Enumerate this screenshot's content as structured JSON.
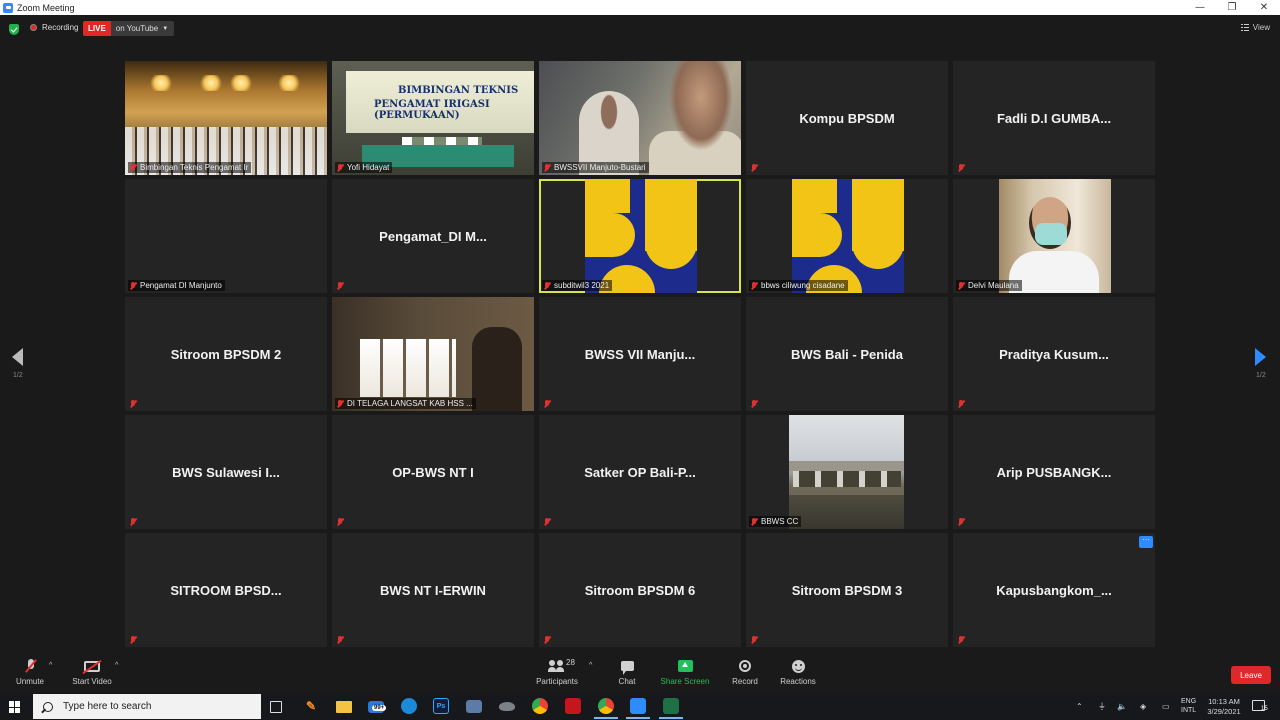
{
  "window": {
    "title": "Zoom Meeting",
    "controls": [
      "—",
      "❐",
      "✕"
    ]
  },
  "topbar": {
    "recording_label": "Recording",
    "live_label": "LIVE",
    "stream_target": "on YouTube",
    "view_label": "View"
  },
  "pagination": {
    "left_page": "1/2",
    "right_page": "1/2"
  },
  "tiles": [
    {
      "display": "video",
      "video": "hall",
      "label": "Bimbingan Teknis Pengamat Ir"
    },
    {
      "display": "video",
      "video": "banner",
      "label": "Yofi Hidayat",
      "banner_line1": "BIMBINGAN TEKNIS",
      "banner_line2": "PENGAMAT IRIGASI (PERMUKAAN)"
    },
    {
      "display": "video",
      "video": "men",
      "label": "BWSSVII Manjuto-Bustari"
    },
    {
      "display": "name",
      "name": "Kompu BPSDM"
    },
    {
      "display": "name",
      "name": "Fadli D.I GUMBA..."
    },
    {
      "display": "label-only",
      "label": "Pengamat DI Manjunto"
    },
    {
      "display": "name",
      "name": "Pengamat_DI M..."
    },
    {
      "display": "video",
      "video": "logo",
      "label": "subditwil3 2021",
      "active": true
    },
    {
      "display": "video",
      "video": "logo",
      "label": "bbws ciliwung cisadane"
    },
    {
      "display": "video",
      "video": "person",
      "label": "Delvi Maulana"
    },
    {
      "display": "name",
      "name": "Sitroom BPSDM 2"
    },
    {
      "display": "video",
      "video": "window",
      "label": "DI TELAGA LANGSAT KAB HSS ..."
    },
    {
      "display": "name",
      "name": "BWSS VII Manju..."
    },
    {
      "display": "name",
      "name": "BWS Bali - Penida"
    },
    {
      "display": "name",
      "name": "Praditya Kusum..."
    },
    {
      "display": "name",
      "name": "BWS Sulawesi I..."
    },
    {
      "display": "name",
      "name": "OP-BWS NT I"
    },
    {
      "display": "name",
      "name": "Satker OP Bali-P..."
    },
    {
      "display": "video",
      "video": "bridge",
      "label": "BBWS CC"
    },
    {
      "display": "name",
      "name": "Arip PUSBANGK..."
    },
    {
      "display": "name",
      "name": "SITROOM BPSD..."
    },
    {
      "display": "name",
      "name": "BWS NT I-ERWIN"
    },
    {
      "display": "name",
      "name": "Sitroom BPSDM 6"
    },
    {
      "display": "name",
      "name": "Sitroom BPSDM 3"
    },
    {
      "display": "name",
      "name": "Kapusbangkom_...",
      "more": true
    }
  ],
  "toolbar": {
    "unmute_label": "Unmute",
    "start_video_label": "Start Video",
    "participants_label": "Participants",
    "participants_count": "28",
    "chat_label": "Chat",
    "share_screen_label": "Share Screen",
    "record_label": "Record",
    "reactions_label": "Reactions",
    "leave_label": "Leave",
    "more_glyph": "···",
    "caret_glyph": "^"
  },
  "taskbar": {
    "search_placeholder": "Type here to search",
    "mail_badge": "99+",
    "photoshop_label": "Ps",
    "lang_line1": "ENG",
    "lang_line2": "INTL",
    "time": "10:13 AM",
    "date": "3/29/2021",
    "notification_count": "15"
  },
  "colors": {
    "accent": "#2d8cff",
    "live_red": "#e02828",
    "share_green": "#22c05a",
    "active_speaker": "#d6e44a",
    "tile_bg": "#242424"
  }
}
